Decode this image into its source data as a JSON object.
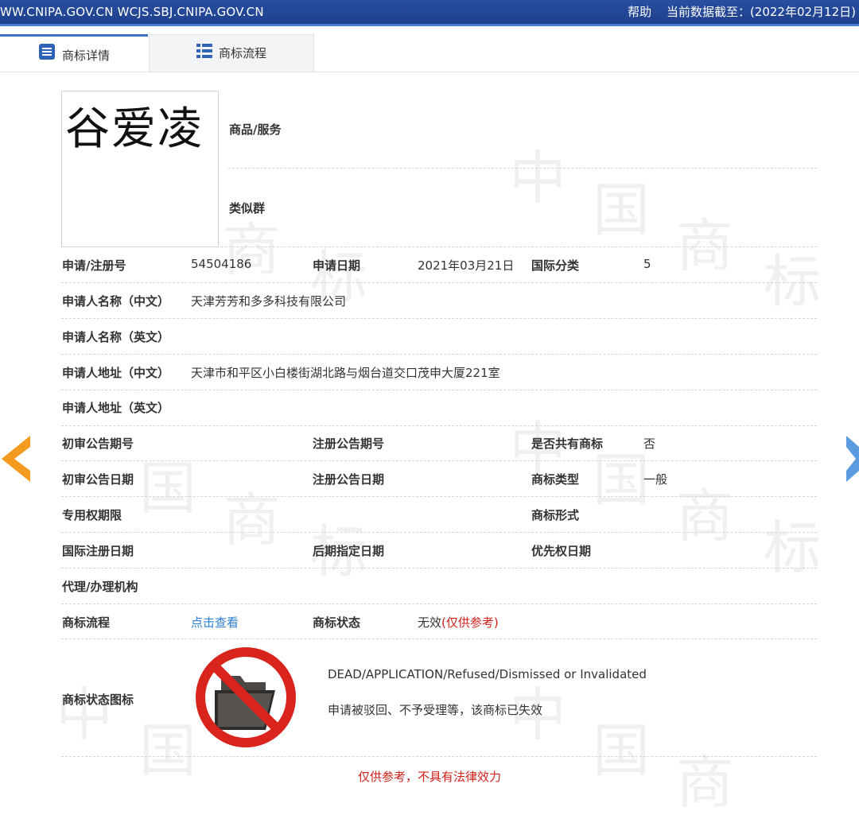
{
  "topbar": {
    "site": "WW.CNIPA.GOV.CN WCJS.SBJ.CNIPA.GOV.CN",
    "help": "帮助",
    "data_date": "当前数据截至：(2022年02月12日)"
  },
  "tabs": [
    {
      "label": "商标详情",
      "icon": "document-list-icon"
    },
    {
      "label": "商标流程",
      "icon": "list-view-icon"
    }
  ],
  "trademark": {
    "image_text": "谷爱凌",
    "goods_services_label": "商品/服务",
    "similar_group_label": "类似群"
  },
  "details": {
    "reg_no_label": "申请/注册号",
    "reg_no": "54504186",
    "apply_date_label": "申请日期",
    "apply_date": "2021年03月21日",
    "intl_class_label": "国际分类",
    "intl_class": "5",
    "applicant_cn_label": "申请人名称（中文）",
    "applicant_cn": "天津芳芳和多多科技有限公司",
    "applicant_en_label": "申请人名称（英文）",
    "address_cn_label": "申请人地址（中文）",
    "address_cn": "天津市和平区小白楼街湖北路与烟台道交口茂申大厦221室",
    "address_en_label": "申请人地址（英文）",
    "prelim_no_label": "初审公告期号",
    "reg_pub_no_label": "注册公告期号",
    "shared_label": "是否共有商标",
    "shared": "否",
    "prelim_date_label": "初审公告日期",
    "reg_pub_date_label": "注册公告日期",
    "tm_type_label": "商标类型",
    "tm_type": "一般",
    "exclusive_period_label": "专用权期限",
    "tm_form_label": "商标形式",
    "intl_reg_date_label": "国际注册日期",
    "later_designation_label": "后期指定日期",
    "priority_date_label": "优先权日期",
    "agent_label": "代理/办理机构",
    "process_label": "商标流程",
    "process_link": "点击查看",
    "status_label": "商标状态",
    "status": "无效",
    "status_note": "(仅供参考)",
    "status_icon_label": "商标状态图标",
    "status_en": "DEAD/APPLICATION/Refused/Dismissed or Invalidated",
    "status_cn": "申请被驳回、不予受理等，该商标已失效"
  },
  "footer_note": "仅供参考，不具有法律效力",
  "colors": {
    "accent": "#2b7fd6",
    "warning": "#d0201a",
    "arrow_left": "#f39a1f",
    "arrow_right": "#5b9be0"
  }
}
